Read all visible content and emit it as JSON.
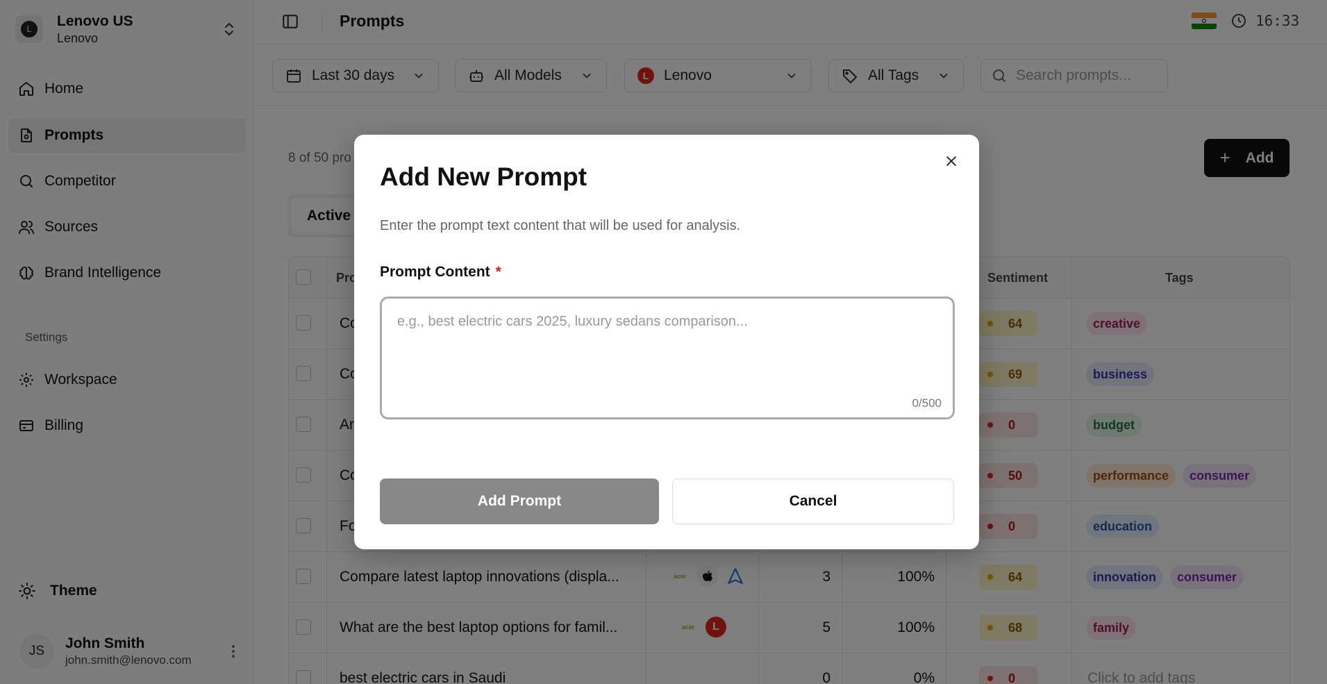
{
  "workspace": {
    "logo_letter": "L",
    "name": "Lenovo US",
    "sub": "Lenovo"
  },
  "sidebar": {
    "items": [
      {
        "label": "Home",
        "icon": "home-icon"
      },
      {
        "label": "Prompts",
        "icon": "prompts-icon",
        "active": true
      },
      {
        "label": "Competitor",
        "icon": "search-icon"
      },
      {
        "label": "Sources",
        "icon": "users-icon"
      },
      {
        "label": "Brand Intelligence",
        "icon": "brain-icon"
      }
    ],
    "settings_label": "Settings",
    "settings_items": [
      {
        "label": "Workspace",
        "icon": "gear-icon"
      },
      {
        "label": "Billing",
        "icon": "card-icon"
      }
    ],
    "theme_label": "Theme",
    "user": {
      "initials": "JS",
      "name": "John Smith",
      "email": "john.smith@lenovo.com"
    }
  },
  "header": {
    "title": "Prompts",
    "time": "16:33"
  },
  "filters": {
    "date": "Last 30 days",
    "models": "All Models",
    "brand": "Lenovo",
    "brand_letter": "L",
    "tags": "All Tags",
    "search_placeholder": "Search prompts..."
  },
  "main": {
    "count_text": "8 of 50 pro",
    "add_label": "Add",
    "tab_active": "Active"
  },
  "table": {
    "headers": {
      "prompt": "Pro",
      "sentiment": "Sentiment",
      "tags": "Tags"
    },
    "rows": [
      {
        "prompt": "Co",
        "sentiment": "64",
        "tone": "y",
        "tags": [
          {
            "label": "creative",
            "c": "pink"
          }
        ]
      },
      {
        "prompt": "Co",
        "sentiment": "69",
        "tone": "y",
        "tags": [
          {
            "label": "business",
            "c": "indigo"
          }
        ]
      },
      {
        "prompt": "An",
        "sentiment": "0",
        "tone": "r",
        "tags": [
          {
            "label": "budget",
            "c": "green"
          }
        ]
      },
      {
        "prompt": "Co",
        "sentiment": "50",
        "tone": "r",
        "tags": [
          {
            "label": "performance",
            "c": "orange"
          },
          {
            "label": "consumer",
            "c": "purple"
          }
        ]
      },
      {
        "prompt": "Fo",
        "sentiment": "0",
        "tone": "r",
        "tags": [
          {
            "label": "education",
            "c": "blue"
          }
        ]
      },
      {
        "prompt": "Compare latest laptop innovations (displa...",
        "mentions": "3",
        "visibility": "100%",
        "sentiment": "64",
        "tone": "y",
        "models": [
          "acer",
          "apple",
          "arc"
        ],
        "tags": [
          {
            "label": "innovation",
            "c": "indigo"
          },
          {
            "label": "consumer",
            "c": "purple"
          }
        ]
      },
      {
        "prompt": "What are the best laptop options for famil...",
        "mentions": "5",
        "visibility": "100%",
        "sentiment": "68",
        "tone": "y",
        "models": [
          "acer",
          "lenovo"
        ],
        "tags": [
          {
            "label": "family",
            "c": "pink"
          }
        ]
      },
      {
        "prompt": "best electric cars in Saudi",
        "mentions": "0",
        "visibility": "0%",
        "sentiment": "0",
        "tone": "r",
        "tags": [],
        "empty_tags": "Click to add tags"
      }
    ]
  },
  "modal": {
    "title": "Add New Prompt",
    "description": "Enter the prompt text content that will be used for analysis.",
    "field_label": "Prompt Content",
    "required_mark": "*",
    "placeholder": "e.g., best electric cars 2025, luxury sedans comparison...",
    "value": "",
    "counter": "0/500",
    "primary_label": "Add Prompt",
    "cancel_label": "Cancel"
  },
  "colors": {
    "brand_red": "#e1251b",
    "primary_disabled": "#888888",
    "overlay": "rgba(0,0,0,0.5)"
  }
}
